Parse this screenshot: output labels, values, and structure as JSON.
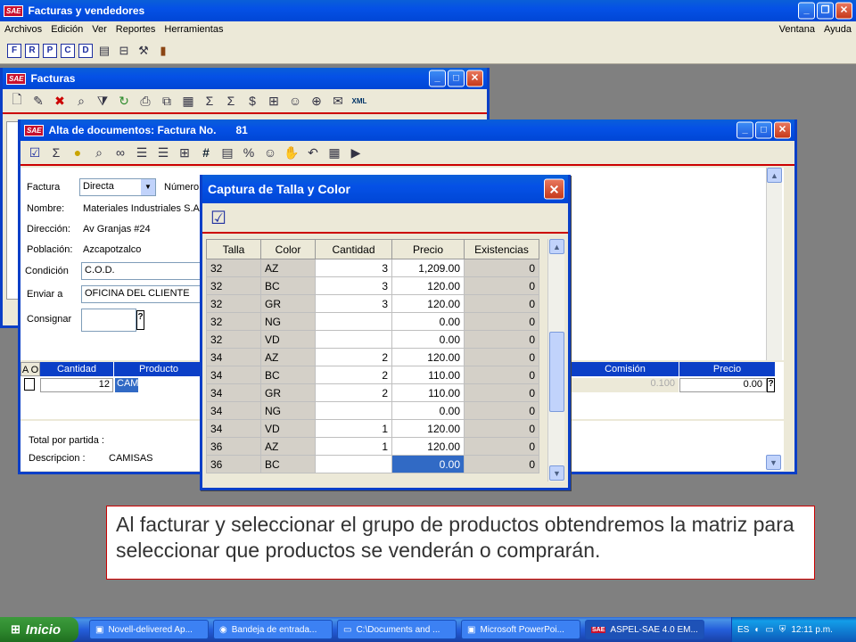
{
  "main_window": {
    "title": "Facturas y vendedores",
    "menu_left": [
      "Archivos",
      "Edición",
      "Ver",
      "Reportes",
      "Herramientas"
    ],
    "menu_right": [
      "Ventana",
      "Ayuda"
    ],
    "toolbar_letters": [
      "F",
      "R",
      "P",
      "C",
      "D"
    ]
  },
  "facturas_window": {
    "title": "Facturas"
  },
  "alta_window": {
    "title": "Alta de documentos: Factura No.",
    "doc_number": "81",
    "fields": {
      "factura_label": "Factura",
      "factura_value": "Directa",
      "numero_label": "Número",
      "nombre_label": "Nombre:",
      "nombre_value": "Materiales Industriales S.A",
      "direccion_label": "Dirección:",
      "direccion_value": "Av Granjas #24",
      "poblacion_label": "Población:",
      "poblacion_value": "Azcapotzalco",
      "condicion_label": "Condición",
      "condicion_value": "C.O.D.",
      "enviar_label": "Enviar a",
      "enviar_value": "OFICINA DEL CLIENTE",
      "consignar_label": "Consignar",
      "help_glyph": "?"
    },
    "grid": {
      "col_ao": "A O",
      "col_cantidad": "Cantidad",
      "col_producto": "Producto",
      "col_comision": "Comisión",
      "col_precio": "Precio",
      "row_cantidad": "12",
      "row_producto": "CAM",
      "row_comision": "0.100",
      "row_precio": "0.00"
    },
    "footer": {
      "total_label": "Total por partida :",
      "desc_label": "Descripcion :",
      "desc_value": "CAMISAS"
    }
  },
  "dialog": {
    "title": "Captura de Talla y Color",
    "headers": [
      "Talla",
      "Color",
      "Cantidad",
      "Precio",
      "Existencias"
    ],
    "rows": [
      [
        "32",
        "AZ",
        "3",
        "1,209.00",
        "0"
      ],
      [
        "32",
        "BC",
        "3",
        "120.00",
        "0"
      ],
      [
        "32",
        "GR",
        "3",
        "120.00",
        "0"
      ],
      [
        "32",
        "NG",
        "",
        "0.00",
        "0"
      ],
      [
        "32",
        "VD",
        "",
        "0.00",
        "0"
      ],
      [
        "34",
        "AZ",
        "2",
        "120.00",
        "0"
      ],
      [
        "34",
        "BC",
        "2",
        "110.00",
        "0"
      ],
      [
        "34",
        "GR",
        "2",
        "110.00",
        "0"
      ],
      [
        "34",
        "NG",
        "",
        "0.00",
        "0"
      ],
      [
        "34",
        "VD",
        "1",
        "120.00",
        "0"
      ],
      [
        "36",
        "AZ",
        "1",
        "120.00",
        "0"
      ],
      [
        "36",
        "BC",
        "",
        "0.00",
        "0"
      ]
    ]
  },
  "caption": "Al facturar y seleccionar el grupo de productos obtendremos la matriz para seleccionar que productos se venderán o comprarán.",
  "taskbar": {
    "start_label": "Inicio",
    "tasks": [
      "Novell-delivered Ap...",
      "Bandeja de entrada...",
      "C:\\Documents and ...",
      "Microsoft PowerPoi...",
      "ASPEL-SAE 4.0 EM..."
    ],
    "lang": "ES",
    "clock": "12:11 p.m."
  },
  "colors": {
    "titlebar": "#0046d5",
    "selected_cell": "#316ac5",
    "caption_border": "#cc0000"
  }
}
